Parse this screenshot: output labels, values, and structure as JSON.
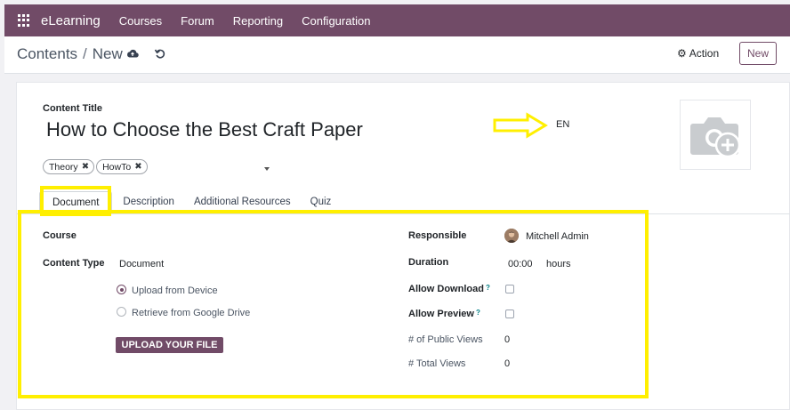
{
  "navbar": {
    "app_name": "eLearning",
    "menu": [
      "Courses",
      "Forum",
      "Reporting",
      "Configuration"
    ]
  },
  "control_panel": {
    "breadcrumb_parent": "Contents",
    "breadcrumb_separator": "/",
    "breadcrumb_current": "New",
    "action_label": "Action",
    "new_label": "New"
  },
  "form": {
    "title_label": "Content Title",
    "title_value": "How to Choose the Best Craft Paper",
    "language": "EN",
    "tags": [
      "Theory",
      "HowTo"
    ],
    "tabs": [
      "Document",
      "Description",
      "Additional Resources",
      "Quiz"
    ],
    "active_tab": "Document",
    "left": {
      "course_label": "Course",
      "content_type_label": "Content Type",
      "content_type_value": "Document",
      "source_options": [
        "Upload from Device",
        "Retrieve from Google Drive"
      ],
      "selected_source": "Upload from Device",
      "upload_button": "UPLOAD YOUR FILE"
    },
    "right": {
      "responsible_label": "Responsible",
      "responsible_value": "Mitchell Admin",
      "duration_label": "Duration",
      "duration_value": "00:00",
      "duration_unit": "hours",
      "allow_download_label": "Allow Download",
      "allow_download_help": "?",
      "allow_download_checked": false,
      "allow_preview_label": "Allow Preview",
      "allow_preview_help": "?",
      "allow_preview_checked": false,
      "public_views_label": "# of Public Views",
      "public_views_value": "0",
      "total_views_label": "# Total Views",
      "total_views_value": "0"
    }
  },
  "colors": {
    "brand": "#714b67",
    "highlight": "#ffef00",
    "help_accent": "#017e84"
  },
  "icons": [
    "apps-grid-icon",
    "cloud-upload-icon",
    "undo-icon",
    "gear-icon",
    "remove-tag-icon",
    "dropdown-caret-icon",
    "camera-plus-icon",
    "arrow-annotation-icon"
  ]
}
